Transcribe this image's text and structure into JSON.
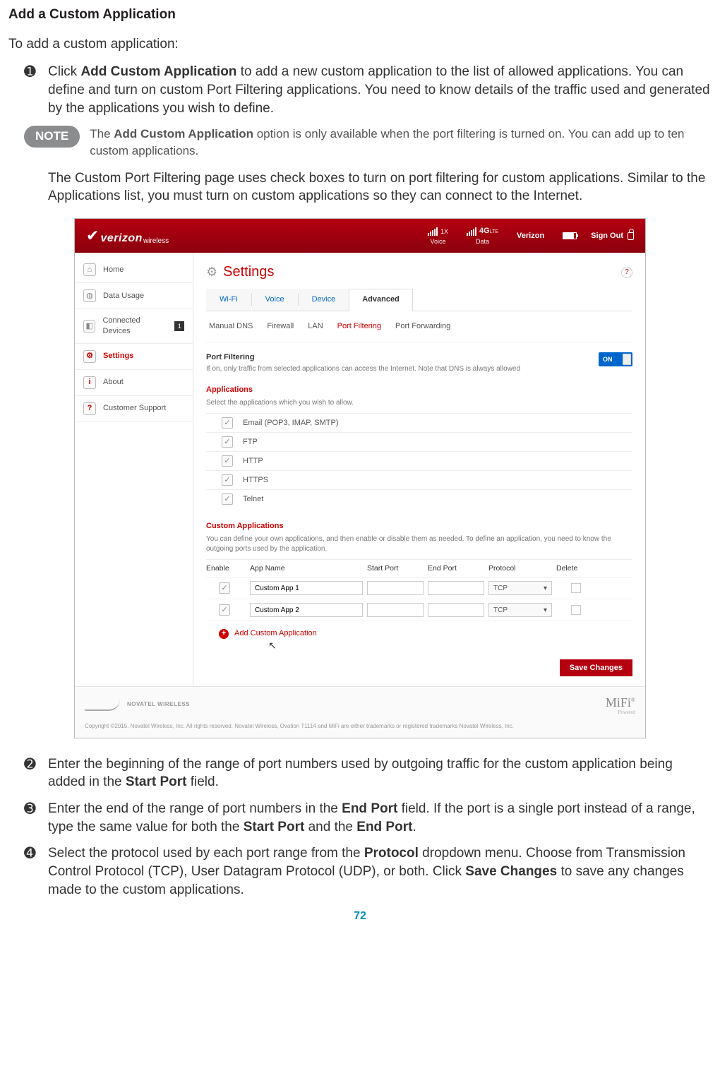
{
  "heading": "Add a Custom Application",
  "intro": "To add a custom application:",
  "steps": {
    "s1": {
      "num": "➊",
      "pre": "Click ",
      "bold": "Add Custom Application",
      "post": " to add a new custom application to the list of allowed applications. You can define and turn on custom Port Filtering applications. You need to know details of the traffic used and generated by the applications you wish to define."
    },
    "s2": {
      "num": "➋",
      "pre": "Enter the beginning of the range of port numbers used by outgoing traffic for the custom application being added in the ",
      "bold": "Start Port",
      "post": " field."
    },
    "s3": {
      "num": "➌",
      "pre": "Enter the end of the range of port numbers in the ",
      "bold1": "End Port",
      "mid1": " field. If the port is a single port instead of a range, type the same value for both the ",
      "bold2": "Start Port",
      "mid2": " and the ",
      "bold3": "End Port",
      "post": "."
    },
    "s4": {
      "num": "➍",
      "pre": "Select the protocol used by each port range from the ",
      "bold1": "Protocol",
      "mid1": " dropdown menu. Choose from Transmission Control Protocol (TCP), User Datagram Protocol (UDP), or both. Click ",
      "bold2": "Save Changes",
      "post": " to save any changes made to the custom applications."
    }
  },
  "note": {
    "badge": "NOTE",
    "pre": "The ",
    "bold": "Add Custom Application",
    "post": " option is only available when the port filtering is turned on. You can add up to ten custom applications."
  },
  "afterNote": "The Custom Port Filtering page uses check boxes to turn on port filtering for custom applications. Similar to the Applications list, you must turn on custom applications so they can connect to the Internet.",
  "topbar": {
    "brand": "verizon",
    "brandSub": "wireless",
    "voice": "Voice",
    "voice1x": "1X",
    "data": "Data",
    "fourg": "4G",
    "lte": "LTE",
    "carrier": "Verizon",
    "signout": "Sign Out"
  },
  "sidebar": {
    "items": [
      {
        "label": "Home"
      },
      {
        "label": "Data Usage"
      },
      {
        "label": "Connected Devices",
        "badge": "1"
      },
      {
        "label": "Settings"
      },
      {
        "label": "About"
      },
      {
        "label": "Customer Support"
      }
    ]
  },
  "main": {
    "title": "Settings",
    "tabs": {
      "wifi": "Wi-Fi",
      "voice": "Voice",
      "device": "Device",
      "advanced": "Advanced"
    },
    "subtabs": {
      "dns": "Manual DNS",
      "fw": "Firewall",
      "lan": "LAN",
      "pf": "Port Filtering",
      "pfw": "Port Forwarding"
    },
    "pfTitle": "Port Filtering",
    "pfDesc": "If on, only traffic from selected applications can access the Internet. Note that DNS is always allowed",
    "toggle": "ON",
    "appsTitle": "Applications",
    "appsDesc": "Select the applications which you wish to allow.",
    "apps": [
      "Email (POP3, IMAP, SMTP)",
      "FTP",
      "HTTP",
      "HTTPS",
      "Telnet"
    ],
    "customTitle": "Custom Applications",
    "customDesc": "You can define your own applications, and then enable or disable them as needed. To define an application, you need to know the outgoing ports used by the application.",
    "cols": {
      "enable": "Enable",
      "name": "App Name",
      "start": "Start Port",
      "end": "End Port",
      "proto": "Protocol",
      "del": "Delete"
    },
    "rows": [
      {
        "name": "Custom App 1",
        "proto": "TCP"
      },
      {
        "name": "Custom App 2",
        "proto": "TCP"
      }
    ],
    "addLink": "Add Custom Application",
    "save": "Save Changes"
  },
  "footer": {
    "novatel": "NOVATEL WIRELESS",
    "mifi": "MiFi",
    "powered": "Powered",
    "copyright": "Copyright ©2015. Novatel Wireless, Inc. All rights reserved. Novatel Wireless, Ovation T1114 and MiFi are either trademarks or registered trademarks Novatel Wireless, Inc."
  },
  "pageNum": "72"
}
